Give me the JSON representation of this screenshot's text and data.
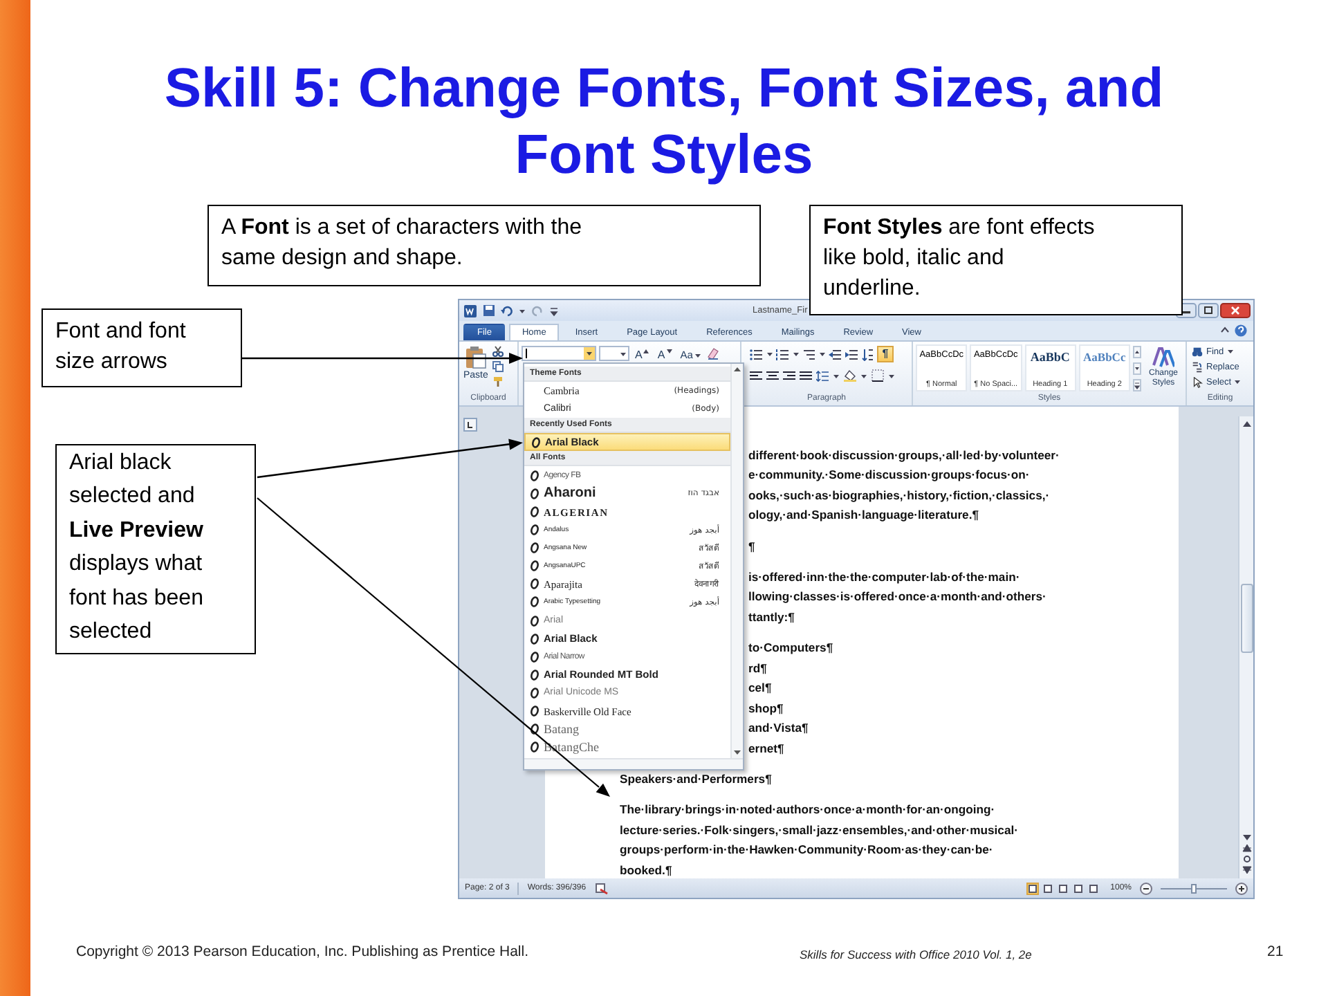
{
  "title": "Skill 5: Change Fonts, Font Sizes, and Font Styles",
  "callouts": [
    {
      "text": "A **Font** is a set of characters with the\nsame design and shape."
    },
    {
      "text": "**Font Styles** are font effects\nlike bold, italic and\nunderline."
    },
    {
      "text": "Font and font\nsize arrows"
    },
    {
      "text": "Arial black\nselected and\n**Live Preview**\ndisplays what\nfont has been\nselected"
    }
  ],
  "word": {
    "title": "Lastname_Fir",
    "tabs": [
      {
        "label": "File",
        "kind": "file",
        "selected": false
      },
      {
        "label": "Home",
        "kind": "tab",
        "selected": true
      },
      {
        "label": "Insert",
        "kind": "tab",
        "selected": false
      },
      {
        "label": "Page Layout",
        "kind": "tab",
        "selected": false
      },
      {
        "label": "References",
        "kind": "tab",
        "selected": false
      },
      {
        "label": "Mailings",
        "kind": "tab",
        "selected": false
      },
      {
        "label": "Review",
        "kind": "tab",
        "selected": false
      },
      {
        "label": "View",
        "kind": "tab",
        "selected": false
      }
    ],
    "ribbon": {
      "clipboard": {
        "label": "Clipboard",
        "paste": "Paste"
      },
      "font": {
        "buttons": [
          "A",
          "A",
          "Aa"
        ]
      },
      "paragraph": {
        "label": "Paragraph",
        "show_marks": {
          "label": "¶",
          "on": true
        }
      },
      "styles": {
        "label": "Styles",
        "items": [
          {
            "preview": "AaBbCcDc",
            "label": "¶ Normal",
            "kind": "body"
          },
          {
            "preview": "AaBbCcDc",
            "label": "¶ No Spaci...",
            "kind": "body"
          },
          {
            "preview": "AaBbC",
            "label": "Heading 1",
            "kind": "heading1"
          },
          {
            "preview": "AaBbCc",
            "label": "Heading 2",
            "kind": "heading2"
          }
        ],
        "change_styles": "Change Styles"
      },
      "editing": {
        "label": "Editing",
        "items": [
          "Find",
          "Replace",
          "Select"
        ]
      }
    },
    "font_menu": {
      "sections": [
        {
          "heading": "Theme Fonts",
          "items": [
            {
              "name": "Cambria",
              "sample": "(Headings)",
              "kind": "serif",
              "icon": false,
              "selected": false
            },
            {
              "name": "Calibri",
              "sample": "(Body)",
              "kind": "plain",
              "icon": false,
              "selected": false
            }
          ]
        },
        {
          "heading": "Recently Used Fonts",
          "items": [
            {
              "name": "Arial Black",
              "kind": "bold",
              "icon": true,
              "selected": true
            }
          ]
        },
        {
          "heading": "All Fonts",
          "items": [
            {
              "name": "Agency FB",
              "kind": "narrow",
              "icon": true,
              "selected": false
            },
            {
              "name": "Aharoni",
              "sample": "אבגד הוז",
              "kind": "heavy",
              "icon": true,
              "selected": false
            },
            {
              "name": "ALGERIAN",
              "kind": "caps",
              "icon": true,
              "selected": false
            },
            {
              "name": "Andalus",
              "sample": "أبجد هوز",
              "kind": "small",
              "icon": true,
              "selected": false
            },
            {
              "name": "Angsana New",
              "sample": "สวัสดี",
              "kind": "small",
              "icon": true,
              "selected": false
            },
            {
              "name": "AngsanaUPC",
              "sample": "สวัสดี",
              "kind": "small",
              "icon": true,
              "selected": false
            },
            {
              "name": "Aparajita",
              "sample": "देवनागरी",
              "kind": "serif",
              "icon": true,
              "selected": false
            },
            {
              "name": "Arabic Typesetting",
              "sample": "أبجد هوز",
              "kind": "small",
              "icon": true,
              "selected": false
            },
            {
              "name": "Arial",
              "kind": "light",
              "icon": true,
              "selected": false
            },
            {
              "name": "Arial Black",
              "kind": "bold",
              "icon": true,
              "selected": false
            },
            {
              "name": "Arial Narrow",
              "kind": "narrow",
              "icon": true,
              "selected": false
            },
            {
              "name": "Arial Rounded MT Bold",
              "kind": "bold",
              "icon": true,
              "selected": false
            },
            {
              "name": "Arial Unicode MS",
              "kind": "light",
              "icon": true,
              "selected": false
            },
            {
              "name": "Baskerville Old Face",
              "kind": "serif",
              "icon": true,
              "selected": false
            },
            {
              "name": "Batang",
              "kind": "serifbig",
              "icon": true,
              "selected": false
            },
            {
              "name": "BatangChe",
              "kind": "serifbig",
              "icon": true,
              "selected": false
            }
          ]
        }
      ]
    },
    "document": {
      "beside_menu": [
        [
          "different·book·discussion·groups,·all·led·by·volunteer·",
          "e·community.·Some·discussion·groups·focus·on·",
          "ooks,·such·as·biographies,·history,·fiction,·classics,·",
          "ology,·and·Spanish·language·literature.¶"
        ],
        [
          "¶"
        ],
        [
          "is·offered·inn·the·the·computer·lab·of·the·main·",
          "llowing·classes·is·offered·once·a·month·and·others·",
          "ttantly:¶"
        ],
        [
          "to·Computers¶",
          "rd¶",
          "cel¶",
          "shop¶",
          "and·Vista¶",
          "ernet¶"
        ]
      ],
      "below_menu": [
        [
          "Speakers·and·Performers¶"
        ],
        [
          "The·library·brings·in·noted·authors·once·a·month·for·an·ongoing·",
          "lecture·series.·Folk·singers,·small·jazz·ensembles,·and·other·musical·",
          "groups·perform·in·the·Hawken·Community·Room·as·they·can·be·",
          "booked.¶"
        ]
      ]
    },
    "status_bar": {
      "page": "Page: 2 of 3",
      "words": "Words: 396/396",
      "zoom": {
        "reading": "100%",
        "level": 0.5
      }
    }
  },
  "footer": {
    "copyright": "Copyright © 2013 Pearson Education, Inc. Publishing as Prentice Hall.",
    "book": "Skills for Success with Office 2010 Vol. 1, 2e",
    "page_number": "21"
  }
}
